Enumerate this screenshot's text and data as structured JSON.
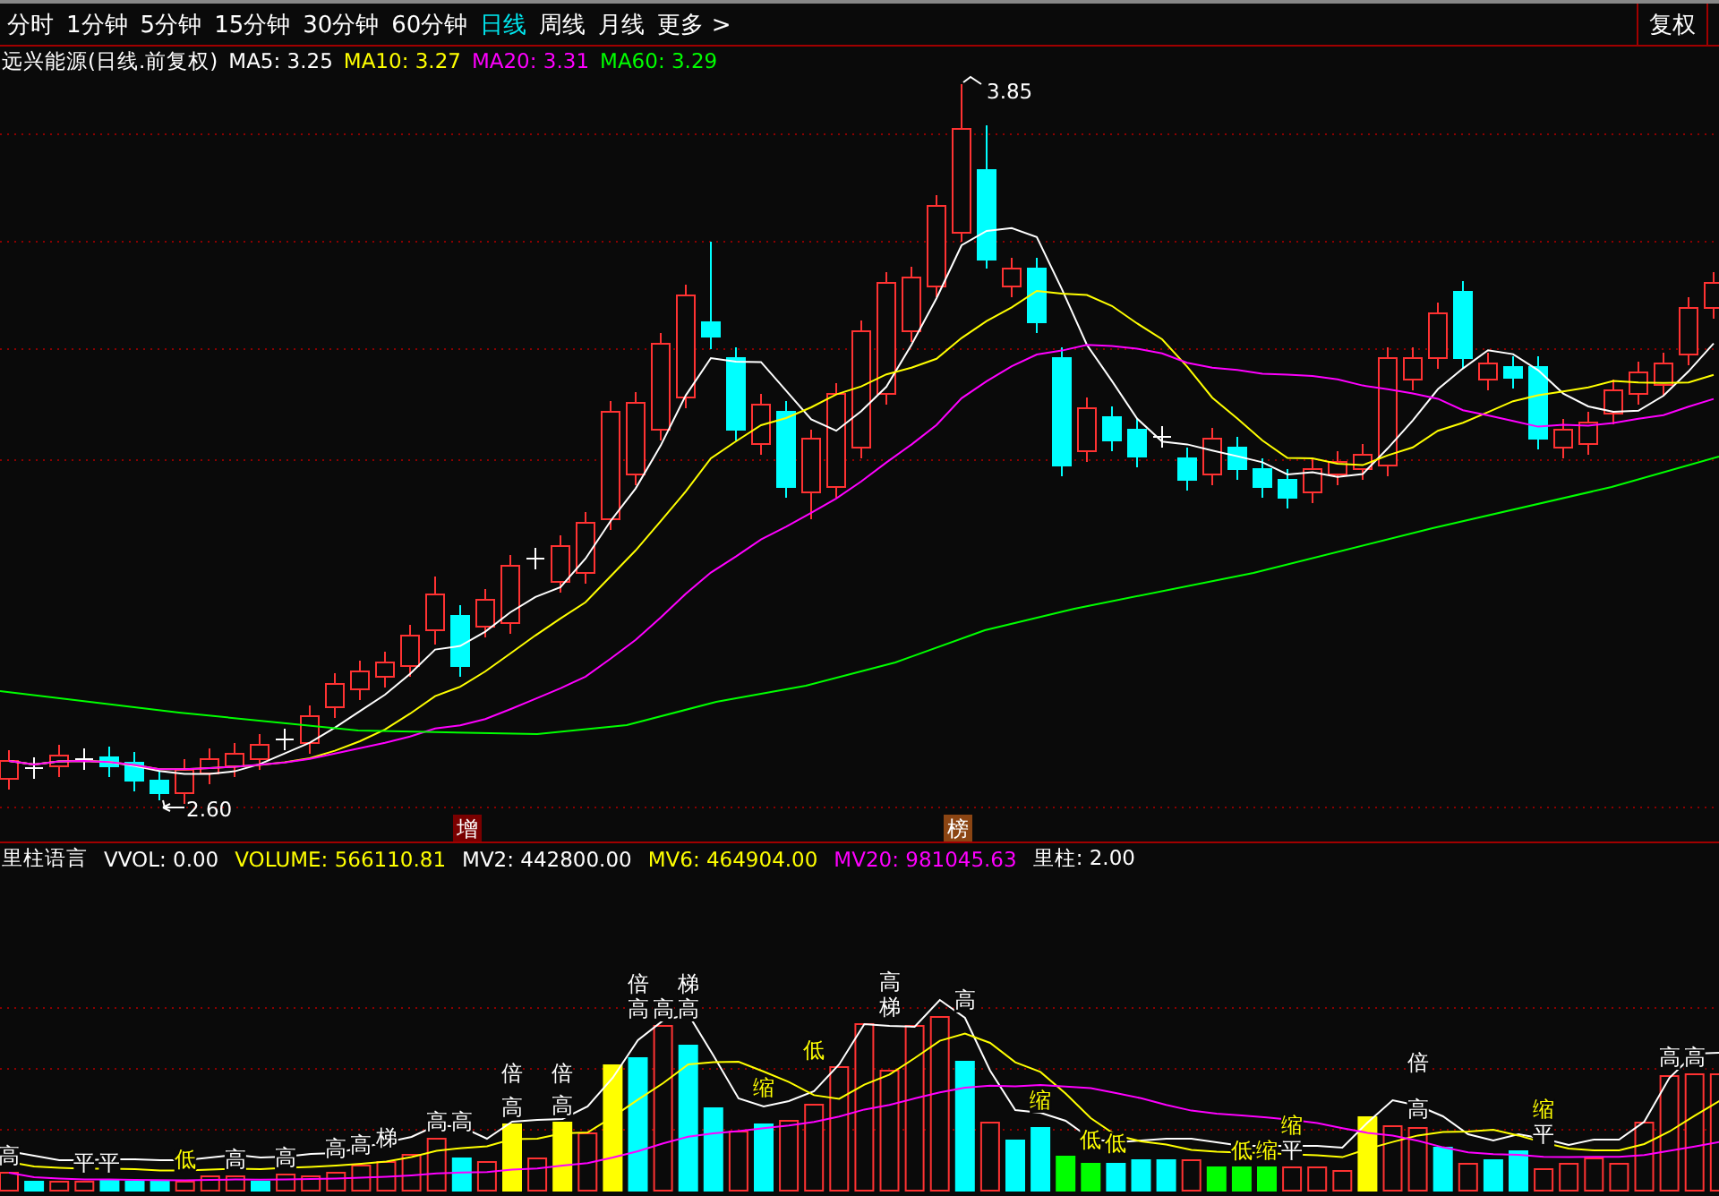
{
  "tabs": [
    {
      "label": "分时",
      "selected": false
    },
    {
      "label": "1分钟",
      "selected": false
    },
    {
      "label": "5分钟",
      "selected": false
    },
    {
      "label": "15分钟",
      "selected": false
    },
    {
      "label": "30分钟",
      "selected": false
    },
    {
      "label": "60分钟",
      "selected": false
    },
    {
      "label": "日线",
      "selected": true
    },
    {
      "label": "周线",
      "selected": false
    },
    {
      "label": "月线",
      "selected": false
    },
    {
      "label": "更多 >",
      "selected": false
    }
  ],
  "adjust_button": "复权",
  "price_legend": [
    {
      "text": "远兴能源(日线.前复权)",
      "color": "#ffffff"
    },
    {
      "text": "MA5: 3.25",
      "color": "#ffffff"
    },
    {
      "text": "MA10: 3.27",
      "color": "#ffff00"
    },
    {
      "text": "MA20: 3.31",
      "color": "#ff00ff"
    },
    {
      "text": "MA60: 3.29",
      "color": "#00ff00"
    }
  ],
  "high_label": "3.85",
  "low_label": "2.60",
  "signals": [
    {
      "text": "增",
      "color": "#7a0000"
    },
    {
      "text": "榜",
      "color": "#8b4513"
    }
  ],
  "volume_legend": [
    {
      "text": "里柱语言",
      "color": "#ffffff"
    },
    {
      "text": "VVOL: 0.00",
      "color": "#ffffff"
    },
    {
      "text": "VOLUME: 566110.81",
      "color": "#ffff00"
    },
    {
      "text": "MV2: 442800.00",
      "color": "#ffffff"
    },
    {
      "text": "MV6: 464904.00",
      "color": "#ffff00"
    },
    {
      "text": "MV20: 981045.63",
      "color": "#ff00ff"
    },
    {
      "text": "里柱: 2.00",
      "color": "#ffffff"
    }
  ],
  "volume_markers": [
    {
      "text": "高",
      "color": "#ffffff"
    },
    {
      "text": "平",
      "color": "#ffffff"
    },
    {
      "text": "平",
      "color": "#ffffff"
    },
    {
      "text": "低",
      "color": "#ffff00"
    },
    {
      "text": "高",
      "color": "#ffffff"
    },
    {
      "text": "高",
      "color": "#ffffff"
    },
    {
      "text": "高",
      "color": "#ffffff"
    },
    {
      "text": "高",
      "color": "#ffffff"
    },
    {
      "text": "梯",
      "color": "#ffffff"
    },
    {
      "text": "高",
      "color": "#ffffff"
    },
    {
      "text": "高",
      "color": "#ffffff"
    },
    {
      "text": "倍",
      "color": "#ffffff"
    },
    {
      "text": "高",
      "color": "#ffffff"
    },
    {
      "text": "倍",
      "color": "#ffffff"
    },
    {
      "text": "高",
      "color": "#ffffff"
    },
    {
      "text": "倍",
      "color": "#ffffff"
    },
    {
      "text": "高",
      "color": "#ffffff"
    },
    {
      "text": "高",
      "color": "#ffffff"
    },
    {
      "text": "梯",
      "color": "#ffffff"
    },
    {
      "text": "高",
      "color": "#ffffff"
    },
    {
      "text": "缩",
      "color": "#ffff00"
    },
    {
      "text": "低",
      "color": "#ffff00"
    },
    {
      "text": "高",
      "color": "#ffffff"
    },
    {
      "text": "梯",
      "color": "#ffffff"
    },
    {
      "text": "高",
      "color": "#ffffff"
    },
    {
      "text": "缩",
      "color": "#ffff00"
    },
    {
      "text": "低",
      "color": "#ffff00"
    },
    {
      "text": "低",
      "color": "#ffff00"
    },
    {
      "text": "低",
      "color": "#ffff00"
    },
    {
      "text": "缩",
      "color": "#ffff00"
    },
    {
      "text": "缩",
      "color": "#ffff00"
    },
    {
      "text": "平",
      "color": "#ffffff"
    },
    {
      "text": "倍",
      "color": "#ffffff"
    },
    {
      "text": "高",
      "color": "#ffffff"
    },
    {
      "text": "缩",
      "color": "#ffff00"
    },
    {
      "text": "平",
      "color": "#ffffff"
    },
    {
      "text": "高",
      "color": "#ffffff"
    },
    {
      "text": "高",
      "color": "#ffffff"
    }
  ]
}
